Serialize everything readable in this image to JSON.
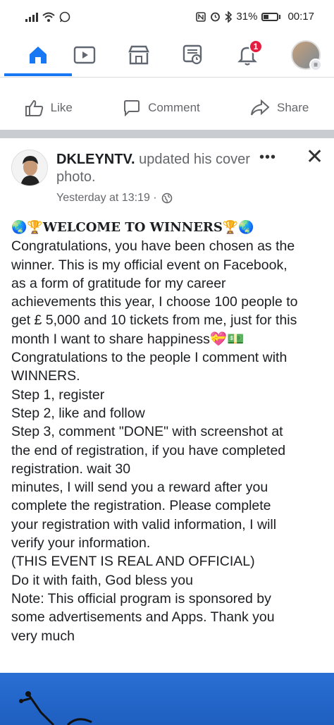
{
  "status_bar": {
    "left_icons": [
      "signal-icon",
      "wifi-icon",
      "whatsapp-icon"
    ],
    "right_icons": [
      "nfc-icon",
      "alarm-icon",
      "bluetooth-icon"
    ],
    "battery": "31%",
    "time": "00:17"
  },
  "nav": {
    "items": [
      {
        "name": "home-icon",
        "active": true
      },
      {
        "name": "watch-icon",
        "active": false
      },
      {
        "name": "marketplace-icon",
        "active": false
      },
      {
        "name": "news-icon",
        "active": false
      },
      {
        "name": "notifications-icon",
        "active": false,
        "badge": "1"
      },
      {
        "name": "profile-menu",
        "active": false
      }
    ],
    "accent": "#1877f2"
  },
  "actions": {
    "like": "Like",
    "comment": "Comment",
    "share": "Share"
  },
  "post": {
    "author": "DKLEYNTV.",
    "action": "updated his cover photo.",
    "time": "Yesterday at 13:19 ·",
    "privacy_icon": "globe-icon",
    "more": "•••",
    "close": "✕",
    "lines": [
      "🌏🏆WELCOME TO WINNERS🏆🌏",
      "Congratulations, you have been chosen as the",
      "winner. This is my official event on Facebook,",
      "as a form of gratitude for my career",
      "achievements this year, I choose 100 people to",
      "get £ 5,000 and 10 tickets from me, just for this",
      "month I want to share happiness💝💵",
      "Congratulations to the people I comment with",
      "WINNERS.",
      "Step 1, register",
      "Step 2, like and follow",
      "Step 3, comment \"DONE\" with screenshot at",
      "the end of registration, if you have completed",
      "registration. wait 30",
      "minutes, I will send you a reward after you",
      "complete the registration. Please complete",
      "your registration with valid information, I will",
      "verify your information.",
      "(THIS EVENT IS REAL AND OFFICIAL)",
      "Do it with faith, God bless you",
      "Note: This official program is sponsored by",
      "some advertisements and Apps. Thank you",
      "very much"
    ]
  }
}
